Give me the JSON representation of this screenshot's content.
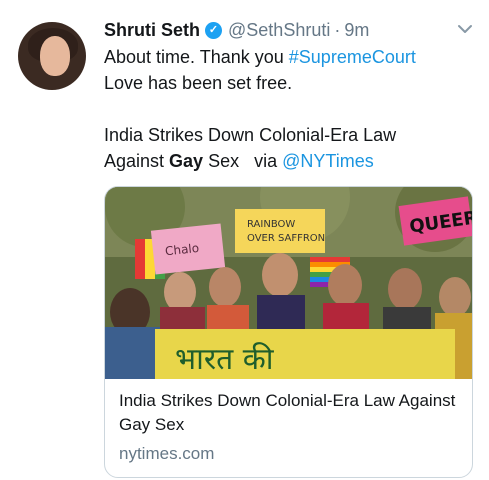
{
  "tweet": {
    "display_name": "Shruti Seth",
    "verified_icon": "verified-badge-icon",
    "handle": "@SethShruti",
    "separator": "·",
    "time": "9m",
    "menu_icon": "chevron-down-icon",
    "text": {
      "line1_prefix": "About time. Thank you ",
      "line1_hashtag": "#SupremeCourt",
      "line2": "Love has been set free.",
      "line3": "India Strikes Down Colonial-Era Law",
      "line4_prefix": "Against ",
      "line4_bold": "Gay",
      "line4_middle": " Sex   via ",
      "line4_mention": "@NYTimes"
    }
  },
  "card": {
    "image_signs": {
      "sign_left": "Chalo",
      "sign_middle": "RAINBOW OVER SAFFRON",
      "sign_right": "QUEER",
      "banner": "भारत की"
    },
    "title": "India Strikes Down Colonial-Era Law Against Gay Sex",
    "domain": "nytimes.com"
  },
  "colors": {
    "link": "#1b95e0",
    "verified": "#1da1f2",
    "secondary_text": "#657786"
  }
}
